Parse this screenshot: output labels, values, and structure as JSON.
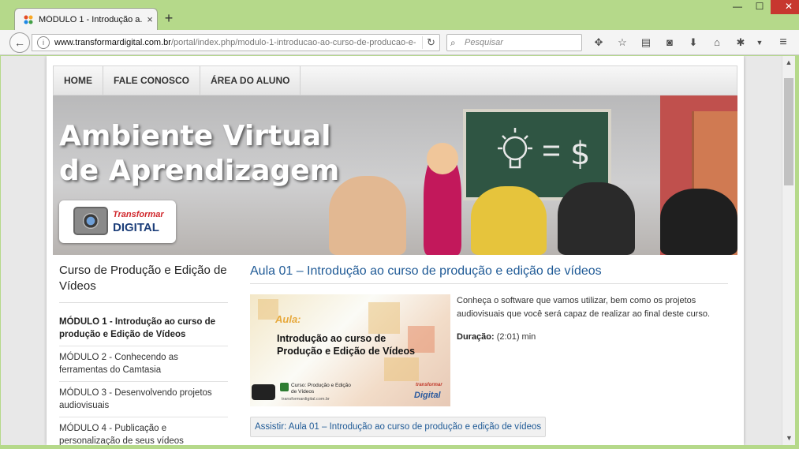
{
  "browser": {
    "tab_title": "MÓDULO 1 - Introdução a...",
    "tab_close": "×",
    "new_tab": "+",
    "url_domain": "www.transformardigital.com.br",
    "url_path": "/portal/index.php/modulo-1-introducao-ao-curso-de-producao-e-",
    "search_placeholder": "Pesquisar",
    "window_controls": {
      "minimize": "—",
      "maximize": "☐",
      "close": "✕"
    }
  },
  "site": {
    "menu": [
      {
        "label": "HOME"
      },
      {
        "label": "FALE CONOSCO"
      },
      {
        "label": "ÁREA DO ALUNO"
      }
    ],
    "banner": {
      "title_line1": "Ambiente Virtual",
      "title_line2": "de Aprendizagem",
      "logo_top": "Transformar",
      "logo_bottom": "DIGITAL"
    },
    "sidebar": {
      "heading": "Curso de Produção e Edição de Vídeos",
      "items": [
        {
          "label": "MÓDULO 1 - Introdução ao curso de produção e Edição de Vídeos",
          "active": true
        },
        {
          "label": "MÓDULO 2 - Conhecendo as ferramentas do Camtasia",
          "active": false
        },
        {
          "label": "MÓDULO 3 - Desenvolvendo projetos audiovisuais",
          "active": false
        },
        {
          "label": "MÓDULO 4 - Publicação e personalização de seus vídeos",
          "active": false
        }
      ]
    },
    "article": {
      "title": "Aula 01 – Introdução ao curso de produção e edição de vídeos",
      "description": "Conheça o software que vamos utilizar, bem como os projetos audiovisuais que você será capaz de realizar ao final deste curso.",
      "duration_label": "Duração:",
      "duration_value": " (2:01) min",
      "watch_button": "Assistir: Aula 01 – Introdução ao curso de produção e edição de vídeos",
      "thumbnail": {
        "aula": "Aula:",
        "line1": "Introdução ao curso de",
        "line2": "Produção e Edição de Vídeos",
        "course_label": "Curso: Produção e Edição",
        "course_label2": "de Vídeos",
        "site": "transformardigital.com.br",
        "brand_small": "transformar",
        "brand": "Digital"
      }
    }
  },
  "colors": {
    "link_blue": "#1f5a96",
    "frame_green": "#b5d98a",
    "close_red": "#c7372f"
  }
}
